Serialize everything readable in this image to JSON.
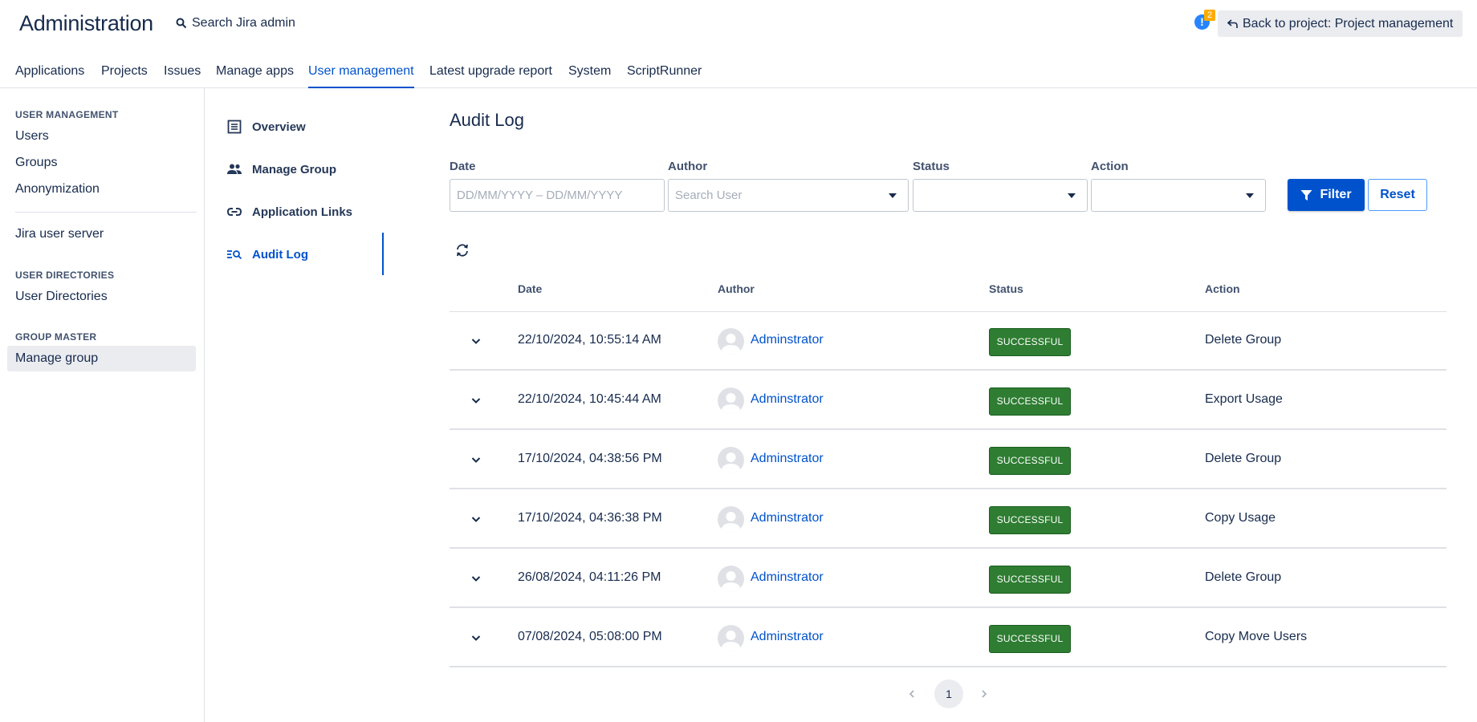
{
  "header": {
    "title": "Administration",
    "search_label": "Search Jira admin",
    "notification_count": "2",
    "notification_glyph": "!",
    "back_label": "Back to project: Project management"
  },
  "nav": {
    "tabs": [
      {
        "label": "Applications",
        "active": false
      },
      {
        "label": "Projects",
        "active": false
      },
      {
        "label": "Issues",
        "active": false
      },
      {
        "label": "Manage apps",
        "active": false
      },
      {
        "label": "User management",
        "active": true
      },
      {
        "label": "Latest upgrade report",
        "active": false
      },
      {
        "label": "System",
        "active": false
      },
      {
        "label": "ScriptRunner",
        "active": false
      }
    ]
  },
  "sidebar": {
    "user_management_heading": "USER MANAGEMENT",
    "users": "Users",
    "groups": "Groups",
    "anonymization": "Anonymization",
    "jira_user_server": "Jira user server",
    "user_directories_heading": "USER DIRECTORIES",
    "user_directories": "User Directories",
    "group_master_heading": "GROUP MASTER",
    "manage_group": "Manage group"
  },
  "subnav": {
    "overview": "Overview",
    "manage_group": "Manage Group",
    "application_links": "Application Links",
    "audit_log": "Audit Log"
  },
  "page": {
    "title": "Audit Log"
  },
  "filters": {
    "date_label": "Date",
    "date_placeholder": "DD/MM/YYYY – DD/MM/YYYY",
    "author_label": "Author",
    "author_placeholder": "Search User",
    "status_label": "Status",
    "action_label": "Action",
    "filter_button": "Filter",
    "reset_button": "Reset"
  },
  "table": {
    "columns": {
      "date": "Date",
      "author": "Author",
      "status": "Status",
      "action": "Action"
    },
    "rows": [
      {
        "date": "22/10/2024, 10:55:14 AM",
        "author": "Adminstrator",
        "status": "SUCCESSFUL",
        "action": "Delete Group"
      },
      {
        "date": "22/10/2024, 10:45:44 AM",
        "author": "Adminstrator",
        "status": "SUCCESSFUL",
        "action": "Export Usage"
      },
      {
        "date": "17/10/2024, 04:38:56 PM",
        "author": "Adminstrator",
        "status": "SUCCESSFUL",
        "action": "Delete Group"
      },
      {
        "date": "17/10/2024, 04:36:38 PM",
        "author": "Adminstrator",
        "status": "SUCCESSFUL",
        "action": "Copy Usage"
      },
      {
        "date": "26/08/2024, 04:11:26 PM",
        "author": "Adminstrator",
        "status": "SUCCESSFUL",
        "action": "Delete Group"
      },
      {
        "date": "07/08/2024, 05:08:00 PM",
        "author": "Adminstrator",
        "status": "SUCCESSFUL",
        "action": "Copy Move Users"
      }
    ]
  },
  "pagination": {
    "current_page": "1"
  },
  "colors": {
    "primary": "#0052cc",
    "success": "#2e7d32",
    "notification": "#2684ff",
    "badge": "#ffab00"
  }
}
